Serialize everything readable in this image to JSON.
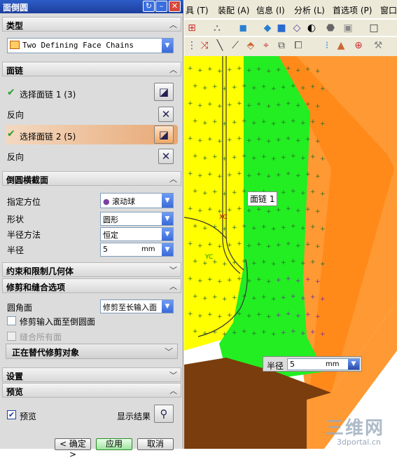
{
  "dialog": {
    "title": "面倒圆",
    "type_section": {
      "title": "类型",
      "value": "Two Defining Face Chains"
    },
    "chain_section": {
      "title": "面链",
      "chain1_label": "选择面链 1 (3)",
      "reverse1": "反向",
      "chain2_label": "选择面链 2 (5)",
      "reverse2": "反向"
    },
    "cross_section": {
      "title": "倒圆横截面",
      "orientation_label": "指定方位",
      "orientation_value": "滚动球",
      "shape_label": "形状",
      "shape_value": "圆形",
      "radius_method_label": "半径方法",
      "radius_method_value": "恒定",
      "radius_label": "半径",
      "radius_value": "5",
      "radius_unit": "mm"
    },
    "constraints_section": {
      "title": "约束和限制几何体"
    },
    "trim_section": {
      "title": "修剪和缝合选项",
      "fillet_face_label": "圆角面",
      "fillet_face_value": "修剪至长输入面",
      "trim_input_label": "修剪输入面至倒圆面",
      "sew_label": "缝合所有面",
      "sub_title": "正在替代修剪对象"
    },
    "settings_section": {
      "title": "设置"
    },
    "preview_section": {
      "title": "预览",
      "preview_label": "预览",
      "show_result_label": "显示结果"
    },
    "buttons": {
      "ok": "< 确定 >",
      "apply": "应用",
      "cancel": "取消"
    }
  },
  "menubar": [
    "具 (T)",
    "装配 (A)",
    "信息 (I)",
    "分析 (L)",
    "首选项 (P)",
    "窗口"
  ],
  "viewport": {
    "tooltip_chain": "面链 1",
    "axis_xc": "XC",
    "axis_yc": "YC",
    "radius_label": "半径",
    "radius_value": "5",
    "radius_unit": "mm"
  },
  "watermark": {
    "logo": "三维网",
    "url": "3dportal.cn"
  },
  "colors": {
    "yellow_face": "#ffff00",
    "green_face": "#22ee22",
    "orange_face": "#ff9933",
    "title_blue": "#1d3f9c"
  }
}
